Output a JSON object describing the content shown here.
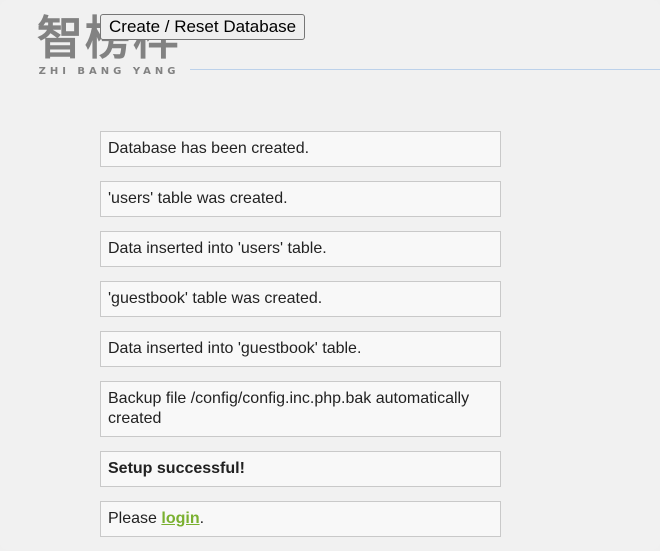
{
  "toolbar": {
    "reset_button_label": "Create / Reset Database"
  },
  "watermark": {
    "main": "智榜样",
    "sub": "ZHI BANG YANG"
  },
  "messages": [
    "Database has been created.",
    "'users' table was created.",
    "Data inserted into 'users' table.",
    "'guestbook' table was created.",
    "Data inserted into 'guestbook' table.",
    "Backup file /config/config.inc.php.bak automatically created",
    "Setup successful!"
  ],
  "login_message": {
    "prefix": "Please ",
    "link_label": "login",
    "suffix": "."
  },
  "colors": {
    "link": "#7ab030",
    "rule": "#bcd1ea"
  }
}
